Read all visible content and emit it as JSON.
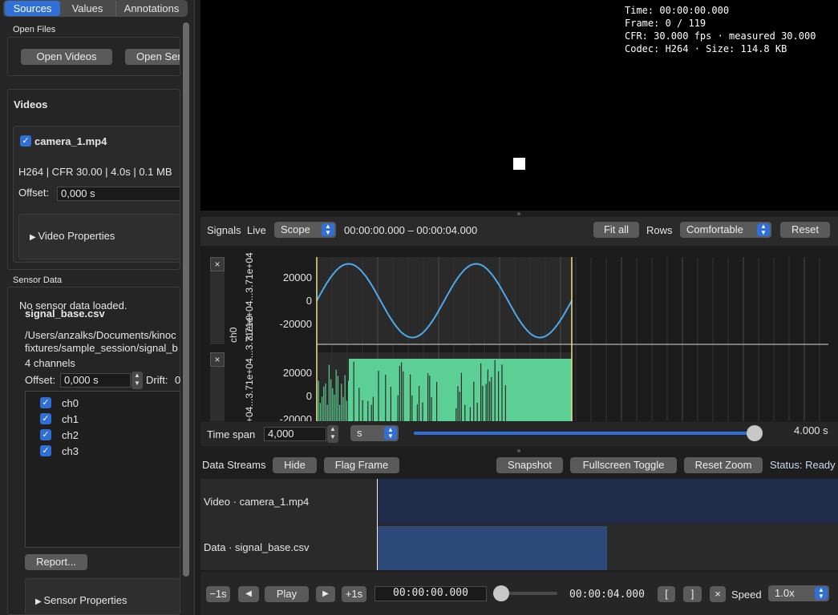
{
  "tabs": [
    {
      "label": "Sources",
      "active": true
    },
    {
      "label": "Values",
      "active": false
    },
    {
      "label": "Annotations",
      "active": false
    }
  ],
  "left": {
    "open_files": {
      "title": "Open Files",
      "open_videos": "Open Videos",
      "open_sensor": "Open Sen"
    },
    "videos": {
      "title": "Videos",
      "item": {
        "name": "camera_1.mp4",
        "checked": true,
        "info": "H264 | CFR 30.00 | 4.0s | 0.1 MB",
        "offset_label": "Offset:",
        "offset_value": "0,000 s",
        "properties": "Video Properties"
      }
    },
    "sensor": {
      "title": "Sensor Data",
      "empty_msg": "No sensor data loaded.",
      "file": "signal_base.csv",
      "path1": "/Users/anzalks/Documents/kinoc",
      "path2": "fixtures/sample_session/signal_b",
      "channels_count": "4 channels",
      "offset_label": "Offset:",
      "offset_value": "0,000 s",
      "drift_label": "Drift:",
      "drift_value": "0",
      "channels": [
        "ch0",
        "ch1",
        "ch2",
        "ch3"
      ],
      "report": "Report...",
      "properties": "Sensor Properties"
    }
  },
  "video_overlay": {
    "time": "Time: 00:00:00.000",
    "frame": "Frame: 0 / 119",
    "cfr": "CFR: 30.000 fps · measured 30.000",
    "codec": "Codec: H264 · Size: 114.8 KB"
  },
  "signals_bar": {
    "signals": "Signals",
    "live": "Live",
    "mode": "Scope",
    "range": "00:00:00.000 – 00:00:04.000",
    "fit_all": "Fit all",
    "rows_label": "Rows",
    "rows_value": "Comfortable",
    "reset": "Reset"
  },
  "plots": {
    "close": "×",
    "ch_label": "ch0",
    "axis_label_1": "3.71e+04...3.71e+04",
    "axis_label_2": "+04...3.71e+04...3.71e+0",
    "ticks": [
      "20000",
      "0",
      "-20000"
    ],
    "ticks2": [
      "20000",
      "0",
      "-20000"
    ],
    "colors": {
      "sine": "#4fa8e8",
      "noise": "#5ccf95",
      "cursor": "#e9e48a"
    }
  },
  "timespan": {
    "label": "Time span",
    "value": "4,000",
    "unit": "s",
    "readout": "4.000 s",
    "slider_fraction": 1.0
  },
  "streams_bar": {
    "label": "Data Streams",
    "hide": "Hide",
    "flag": "Flag Frame",
    "snapshot": "Snapshot",
    "fullscreen": "Fullscreen Toggle",
    "reset_zoom": "Reset Zoom",
    "status": "Status: Ready"
  },
  "tracks": [
    {
      "label": "Video · camera_1.mp4"
    },
    {
      "label": "Data · signal_base.csv"
    }
  ],
  "transport": {
    "back1": "−1s",
    "prev": "◀",
    "play": "Play",
    "next": "▶",
    "fwd1": "+1s",
    "current": "00:00:00.000",
    "end": "00:00:04.000",
    "in": "[",
    "out": "]",
    "clear": "×",
    "speed_label": "Speed",
    "speed_value": "1.0x"
  }
}
